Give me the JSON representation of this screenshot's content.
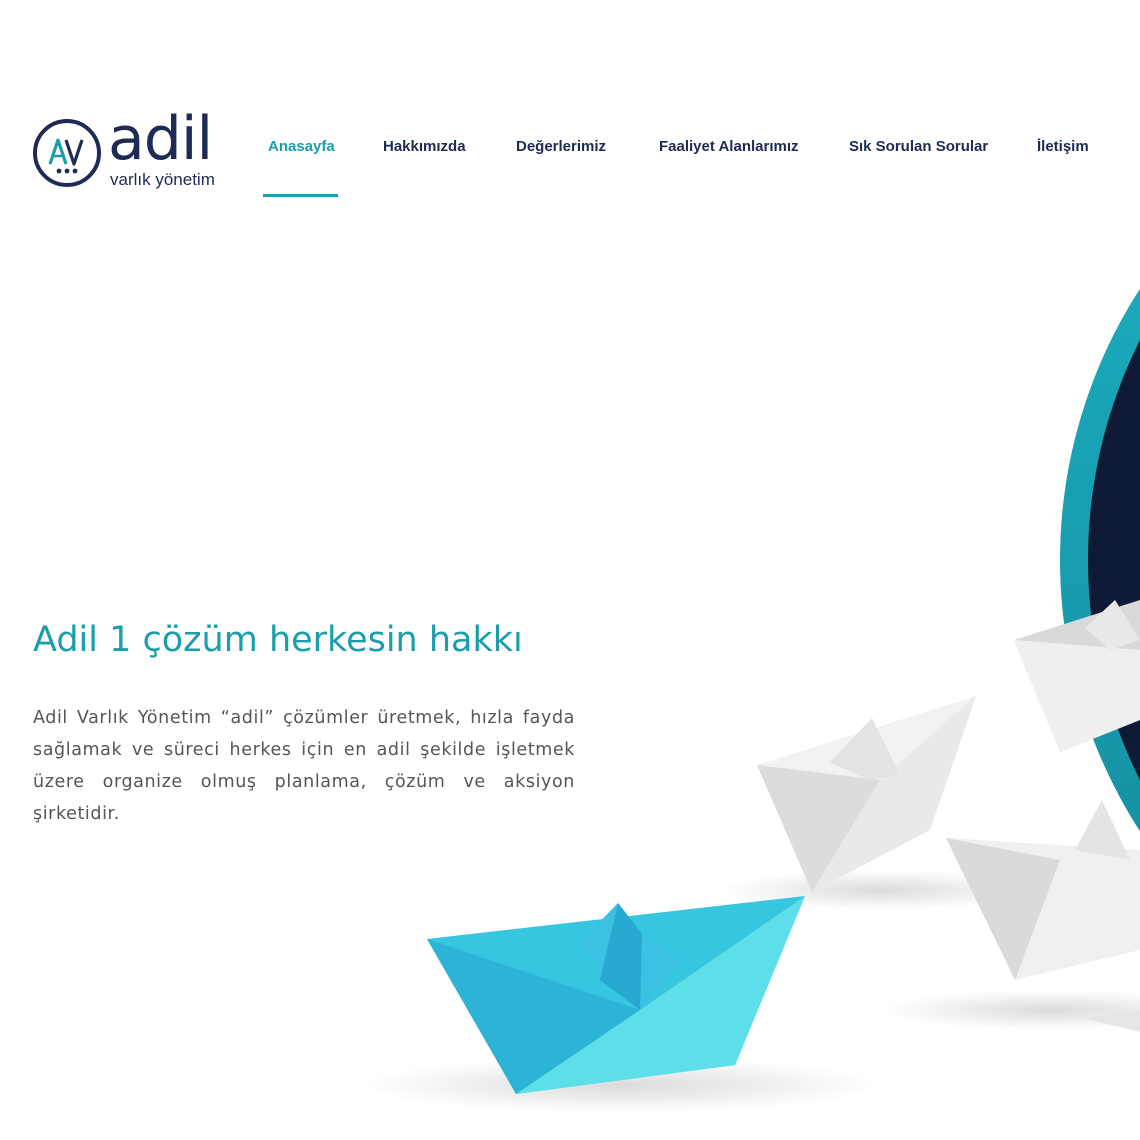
{
  "brand": {
    "monogram": "AV",
    "name": "adil",
    "tagline": "varlık yönetim",
    "colors": {
      "primary": "#1e2c55",
      "accent": "#1a9eac"
    }
  },
  "nav": {
    "items": [
      {
        "label": "Anasayfa",
        "active": true
      },
      {
        "label": "Hakkımızda"
      },
      {
        "label": "Değerlerimiz"
      },
      {
        "label": "Faaliyet Alanlarımız"
      },
      {
        "label": "Sık Sorulan Sorular"
      },
      {
        "label": "İletişim"
      }
    ]
  },
  "hero": {
    "title": "Adil 1 çözüm herkesin hakkı",
    "body": "Adil Varlık Yönetim “adil” çözümler üretmek, hızla fayda sağlamak ve süreci herkes için en adil şekilde işletmek üzere organize olmuş planlama, çözüm ve aksiyon şirketidir.",
    "image": "paper-boats-illustration"
  }
}
